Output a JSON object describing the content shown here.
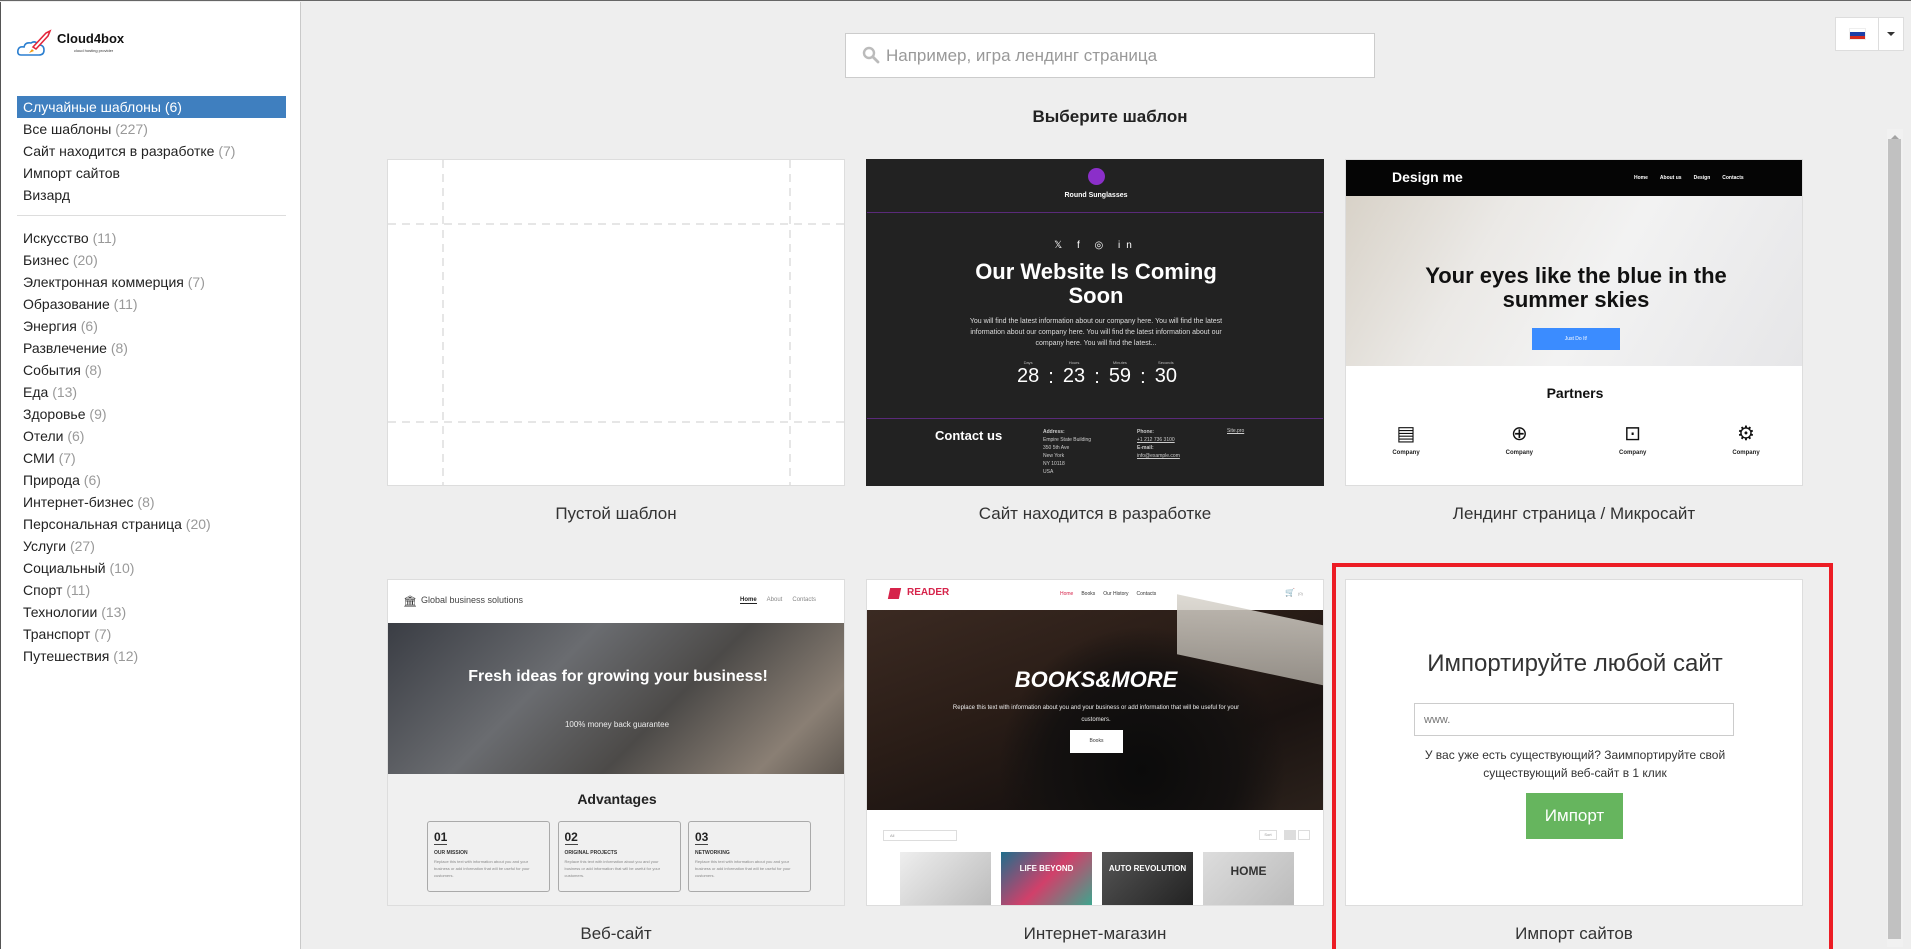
{
  "logo": {
    "name": "Cloud4box",
    "tagline": "cloud hosting provider"
  },
  "sidebar": {
    "primary": [
      {
        "label": "Случайные шаблоны (6)",
        "count": "",
        "active": true
      },
      {
        "label": "Все шаблоны",
        "count": "(227)"
      },
      {
        "label": "Сайт находится в разработке",
        "count": "(7)"
      },
      {
        "label": "Импорт сайтов",
        "count": ""
      },
      {
        "label": "Визард",
        "count": ""
      }
    ],
    "categories": [
      {
        "label": "Искусство",
        "count": "(11)"
      },
      {
        "label": "Бизнес",
        "count": "(20)"
      },
      {
        "label": "Электронная коммерция",
        "count": "(7)"
      },
      {
        "label": "Образование",
        "count": "(11)"
      },
      {
        "label": "Энергия",
        "count": "(6)"
      },
      {
        "label": "Развлечение",
        "count": "(8)"
      },
      {
        "label": "События",
        "count": "(8)"
      },
      {
        "label": "Еда",
        "count": "(13)"
      },
      {
        "label": "Здоровье",
        "count": "(9)"
      },
      {
        "label": "Отели",
        "count": "(6)"
      },
      {
        "label": "СМИ",
        "count": "(7)"
      },
      {
        "label": "Природа",
        "count": "(6)"
      },
      {
        "label": "Интернет-бизнес",
        "count": "(8)"
      },
      {
        "label": "Персональная страница",
        "count": "(20)"
      },
      {
        "label": "Услуги",
        "count": "(27)"
      },
      {
        "label": "Социальный",
        "count": "(10)"
      },
      {
        "label": "Спорт",
        "count": "(11)"
      },
      {
        "label": "Технологии",
        "count": "(13)"
      },
      {
        "label": "Транспорт",
        "count": "(7)"
      },
      {
        "label": "Путешествия",
        "count": "(12)"
      }
    ]
  },
  "search": {
    "placeholder": "Например, игра лендинг страница",
    "value": ""
  },
  "heading": "Выберите шаблон",
  "language": {
    "selected": "ru",
    "flag_colors": [
      "#ffffff",
      "#1c3fa8",
      "#d52b1e"
    ]
  },
  "templates": [
    {
      "label": "Пустой шаблон"
    },
    {
      "label": "Сайт находится в разработке",
      "preview": {
        "brand": "Round Sunglasses",
        "title": "Our Website Is Coming Soon",
        "text": "You will find the latest information about our company here. You will find the latest information about our company here. You will find the latest information about our company here. You will find the latest...",
        "countdown": [
          {
            "unit": "Days",
            "value": "28"
          },
          {
            "unit": "Hours",
            "value": "23"
          },
          {
            "unit": "Minutes",
            "value": "59"
          },
          {
            "unit": "Seconds",
            "value": "30"
          }
        ],
        "contact_title": "Contact us",
        "address_label": "Address:",
        "address": [
          "Empire State Building",
          "350 5th Ave",
          "New York",
          "NY 10118",
          "USA"
        ],
        "phone_label": "Phone:",
        "phone": "+1 212 736 3100",
        "email_label": "E-mail:",
        "email": "info@example.com",
        "credit": "Site.pro"
      }
    },
    {
      "label": "Лендинг страница / Микросайт",
      "preview": {
        "brand": "Design me",
        "nav": [
          "Home",
          "About us",
          "Design",
          "Contacts"
        ],
        "title": "Your eyes like the blue in the summer skies",
        "button": "Just Do It!",
        "partners_title": "Partners",
        "partner_label": "Company"
      }
    },
    {
      "label": "Веб-сайт",
      "preview": {
        "brand": "Global business solutions",
        "nav": [
          "Home",
          "About",
          "Contacts"
        ],
        "title": "Fresh ideas for growing your business!",
        "subtitle": "100% money back guarantee",
        "section_title": "Advantages",
        "items": [
          {
            "num": "01",
            "title": "OUR MISSION"
          },
          {
            "num": "02",
            "title": "ORIGINAL PROJECTS"
          },
          {
            "num": "03",
            "title": "NETWORKING"
          }
        ],
        "item_text": "Replace this text with information about you and your business or add information that will be useful for your customers."
      }
    },
    {
      "label": "Интернет-магазин",
      "preview": {
        "brand": "READER",
        "nav": [
          "Home",
          "Books",
          "Our History",
          "Contacts"
        ],
        "cart": "(0)",
        "title": "BOOKS&MORE",
        "text": "Replace this text with information about you and your business or add information that will be useful for your customers.",
        "button": "Books",
        "filter": "All",
        "sort": "Sort",
        "books": [
          "",
          "LIFE BEYOND",
          "AUTO REVOLUTION",
          "HOME"
        ]
      }
    },
    {
      "label": "Импорт сайтов",
      "import": {
        "title": "Импортируйте любой сайт",
        "placeholder": "www.",
        "description": "У вас уже есть существующий? Заимпортируйте свой существующий веб-сайт в 1 клик",
        "button": "Импорт"
      }
    }
  ],
  "colors": {
    "active_nav": "#3f7fbf",
    "import_button": "#66b55e",
    "highlight": "#ec1c24"
  }
}
